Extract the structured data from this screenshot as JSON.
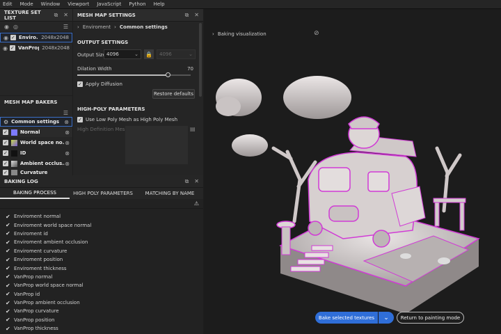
{
  "menu": [
    "Edit",
    "Mode",
    "Window",
    "Viewport",
    "JavaScript",
    "Python",
    "Help"
  ],
  "texture_set_list": {
    "title": "TEXTURE SET LIST",
    "items": [
      {
        "name": "Enviro...",
        "res": "2048x2048"
      },
      {
        "name": "VanProp",
        "res": "2048x2048"
      }
    ]
  },
  "mesh_map_bakers": {
    "title": "MESH MAP BAKERS",
    "items": [
      "Common settings",
      "Normal",
      "World space no...",
      "ID",
      "Ambient occlus...",
      "Curvature"
    ]
  },
  "mesh_map_settings": {
    "title": "MESH MAP SETTINGS",
    "breadcrumb": [
      "Enviroment",
      "Common settings"
    ],
    "output_title": "OUTPUT SETTINGS",
    "output_size_label": "Output Size",
    "output_size": "4096",
    "output_size_locked": "4096",
    "dilation_label": "Dilation Width",
    "dilation_value": "70",
    "dilation_fraction": 0.8,
    "apply_diffusion": "Apply Diffusion",
    "restore_defaults": "Restore defaults",
    "highpoly_title": "HIGH-POLY PARAMETERS",
    "use_low_poly": "Use Low Poly Mesh as High Poly Mesh",
    "high_def_meshes": "High Definition Meshes"
  },
  "baking_log": {
    "title": "BAKING LOG",
    "tabs": [
      "BAKING PROCESS",
      "HIGH POLY PARAMETERS",
      "MATCHING BY NAME"
    ],
    "entries": [
      "Enviroment normal",
      "Enviroment world space normal",
      "Enviroment id",
      "Enviroment ambient occlusion",
      "Enviroment curvature",
      "Enviroment position",
      "Enviroment thickness",
      "VanProp normal",
      "VanProp world space normal",
      "VanProp id",
      "VanProp ambient occlusion",
      "VanProp curvature",
      "VanProp position",
      "VanProp thickness"
    ]
  },
  "viewport": {
    "baking_visualization": "Baking visualization",
    "bake_button": "Bake selected textures",
    "return_button": "Return to painting mode"
  },
  "colors": {
    "accent": "#2f6ed8",
    "highlight_edges": "#d13ad6",
    "normal_swatch": "#7d7bff"
  }
}
